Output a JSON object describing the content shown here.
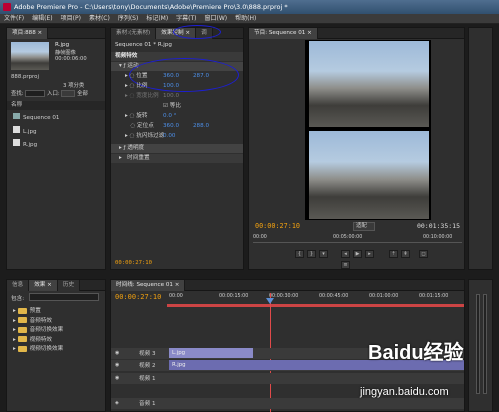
{
  "window": {
    "title": "Adobe Premiere Pro - C:\\Users\\tony\\Documents\\Adobe\\Premiere Pro\\3.0\\888.prproj *"
  },
  "menu": [
    "文件(F)",
    "编辑(E)",
    "项目(P)",
    "素材(C)",
    "序列(S)",
    "标记(M)",
    "字幕(T)",
    "窗口(W)",
    "帮助(H)"
  ],
  "project": {
    "tab": "项目:888 ×",
    "clip_name": "R.jpg",
    "clip_type": "静帧图像",
    "clip_duration": "00:00:06:00",
    "project_file": "888.prproj",
    "item_count": "3 项分类",
    "find_label": "查找:",
    "in_label": "入口:",
    "in_value": "全部",
    "column_header": "名称",
    "items": [
      "Sequence 01",
      "L.jpg",
      "R.jpg"
    ]
  },
  "effect_controls": {
    "tabs": [
      "素材:(无素材)",
      "效果控制 ×",
      "调"
    ],
    "header": "Sequence 01 * R.jpg",
    "section": "视频特效",
    "motion": "运动",
    "position_label": "位置",
    "position_x": "360.0",
    "position_y": "287.0",
    "scale_label": "比例",
    "scale_value": "100.0",
    "scale_width_label": "宽度比例",
    "scale_width_value": "100.0",
    "uniform_label": "等比",
    "rotation_label": "旋转",
    "rotation_value": "0.0 °",
    "anchor_label": "定位点",
    "anchor_x": "360.0",
    "anchor_y": "288.0",
    "flicker_label": "抗闪烁过滤",
    "flicker_value": "0.00",
    "opacity_label": "透明度",
    "remap_label": "时间重置",
    "timecode": "00:00:27:10"
  },
  "monitor": {
    "tab": "节目: Sequence 01 ×",
    "timecode_left": "00:00:27:10",
    "fit_label": "适配",
    "timecode_right": "00:01:35:15",
    "ruler": [
      "00:00",
      "00:05:00:00",
      "00:10:00:00"
    ]
  },
  "effects_panel": {
    "tabs": [
      "信息",
      "效果 ×",
      "历史"
    ],
    "search_label": "包含:",
    "folders": [
      "预置",
      "音频特效",
      "音频切换效果",
      "视频特效",
      "视频切换效果"
    ]
  },
  "timeline": {
    "tab": "时间线: Sequence 01 ×",
    "timecode": "00:00:27:10",
    "ruler": [
      "00:00",
      "00:00:15:00",
      "00:00:30:00",
      "00:00:45:00",
      "00:01:00:00",
      "00:01:15:00"
    ],
    "tracks": [
      {
        "name": "视频 3",
        "clip": "L.jpg"
      },
      {
        "name": "视频 2",
        "clip": "R.jpg"
      },
      {
        "name": "视频 1",
        "clip": ""
      },
      {
        "name": "音频 1",
        "clip": ""
      }
    ]
  },
  "watermark": {
    "logo": "Baidu经验",
    "url": "jingyan.baidu.com"
  },
  "colors": {
    "timecode": "#f0a010",
    "value": "#4d8fe8",
    "annotation": "#1d1fd0",
    "clip_video3": "#8a8ac8",
    "clip_video2": "#6c6cb0"
  }
}
